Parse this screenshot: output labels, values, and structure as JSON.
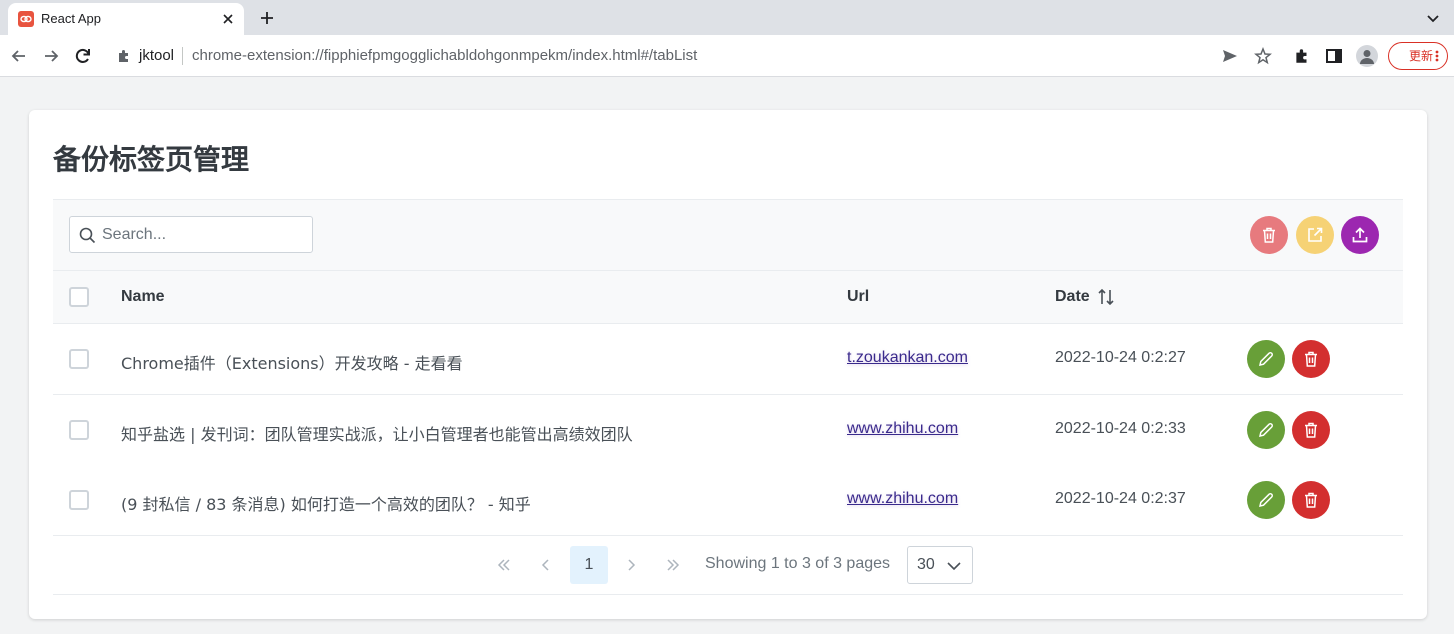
{
  "browser": {
    "tab_title": "React App",
    "site_name": "jktool",
    "url": "chrome-extension://fipphiefpmgogglichabldohgonmpekm/index.html#/tabList",
    "update_label": "更新"
  },
  "page": {
    "title": "备份标签页管理",
    "search_placeholder": "Search..."
  },
  "table": {
    "columns": {
      "name": "Name",
      "url": "Url",
      "date": "Date"
    },
    "rows": [
      {
        "name": "Chrome插件（Extensions）开发攻略 - 走看看",
        "url": "t.zoukankan.com",
        "date": "2022-10-24 0:2:27"
      },
      {
        "name": "知乎盐选 | 发刊词：团队管理实战派，让小白管理者也能管出高绩效团队",
        "url": "www.zhihu.com",
        "date": "2022-10-24 0:2:33"
      },
      {
        "name": "(9 封私信 / 83 条消息) 如何打造一个高效的团队？ - 知乎",
        "url": "www.zhihu.com",
        "date": "2022-10-24 0:2:37"
      }
    ]
  },
  "paginator": {
    "current_page": "1",
    "report": "Showing 1 to 3 of 3 pages",
    "rows_per_page": "30"
  },
  "colors": {
    "delete_selected": "#e77a7e",
    "open_selected": "#f6d275",
    "export": "#9c27b0",
    "edit": "#689f38",
    "delete": "#d32f2f"
  }
}
